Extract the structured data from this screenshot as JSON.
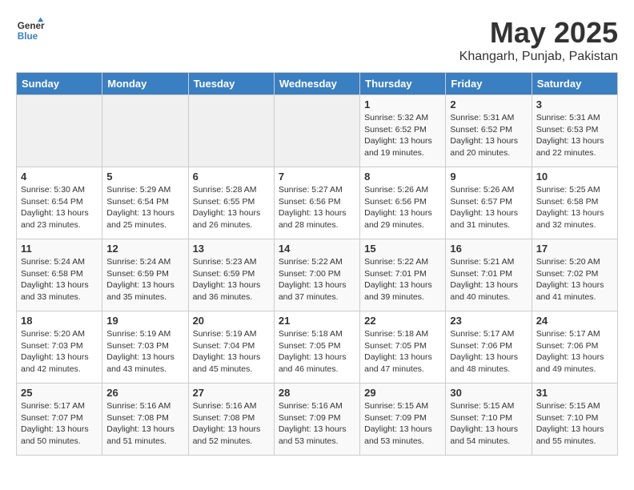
{
  "header": {
    "logo_line1": "General",
    "logo_line2": "Blue",
    "month_year": "May 2025",
    "location": "Khangarh, Punjab, Pakistan"
  },
  "days_of_week": [
    "Sunday",
    "Monday",
    "Tuesday",
    "Wednesday",
    "Thursday",
    "Friday",
    "Saturday"
  ],
  "weeks": [
    [
      {
        "num": "",
        "empty": true
      },
      {
        "num": "",
        "empty": true
      },
      {
        "num": "",
        "empty": true
      },
      {
        "num": "",
        "empty": true
      },
      {
        "num": "1",
        "info": "Sunrise: 5:32 AM\nSunset: 6:52 PM\nDaylight: 13 hours\nand 19 minutes."
      },
      {
        "num": "2",
        "info": "Sunrise: 5:31 AM\nSunset: 6:52 PM\nDaylight: 13 hours\nand 20 minutes."
      },
      {
        "num": "3",
        "info": "Sunrise: 5:31 AM\nSunset: 6:53 PM\nDaylight: 13 hours\nand 22 minutes."
      }
    ],
    [
      {
        "num": "4",
        "info": "Sunrise: 5:30 AM\nSunset: 6:54 PM\nDaylight: 13 hours\nand 23 minutes."
      },
      {
        "num": "5",
        "info": "Sunrise: 5:29 AM\nSunset: 6:54 PM\nDaylight: 13 hours\nand 25 minutes."
      },
      {
        "num": "6",
        "info": "Sunrise: 5:28 AM\nSunset: 6:55 PM\nDaylight: 13 hours\nand 26 minutes."
      },
      {
        "num": "7",
        "info": "Sunrise: 5:27 AM\nSunset: 6:56 PM\nDaylight: 13 hours\nand 28 minutes."
      },
      {
        "num": "8",
        "info": "Sunrise: 5:26 AM\nSunset: 6:56 PM\nDaylight: 13 hours\nand 29 minutes."
      },
      {
        "num": "9",
        "info": "Sunrise: 5:26 AM\nSunset: 6:57 PM\nDaylight: 13 hours\nand 31 minutes."
      },
      {
        "num": "10",
        "info": "Sunrise: 5:25 AM\nSunset: 6:58 PM\nDaylight: 13 hours\nand 32 minutes."
      }
    ],
    [
      {
        "num": "11",
        "info": "Sunrise: 5:24 AM\nSunset: 6:58 PM\nDaylight: 13 hours\nand 33 minutes."
      },
      {
        "num": "12",
        "info": "Sunrise: 5:24 AM\nSunset: 6:59 PM\nDaylight: 13 hours\nand 35 minutes."
      },
      {
        "num": "13",
        "info": "Sunrise: 5:23 AM\nSunset: 6:59 PM\nDaylight: 13 hours\nand 36 minutes."
      },
      {
        "num": "14",
        "info": "Sunrise: 5:22 AM\nSunset: 7:00 PM\nDaylight: 13 hours\nand 37 minutes."
      },
      {
        "num": "15",
        "info": "Sunrise: 5:22 AM\nSunset: 7:01 PM\nDaylight: 13 hours\nand 39 minutes."
      },
      {
        "num": "16",
        "info": "Sunrise: 5:21 AM\nSunset: 7:01 PM\nDaylight: 13 hours\nand 40 minutes."
      },
      {
        "num": "17",
        "info": "Sunrise: 5:20 AM\nSunset: 7:02 PM\nDaylight: 13 hours\nand 41 minutes."
      }
    ],
    [
      {
        "num": "18",
        "info": "Sunrise: 5:20 AM\nSunset: 7:03 PM\nDaylight: 13 hours\nand 42 minutes."
      },
      {
        "num": "19",
        "info": "Sunrise: 5:19 AM\nSunset: 7:03 PM\nDaylight: 13 hours\nand 43 minutes."
      },
      {
        "num": "20",
        "info": "Sunrise: 5:19 AM\nSunset: 7:04 PM\nDaylight: 13 hours\nand 45 minutes."
      },
      {
        "num": "21",
        "info": "Sunrise: 5:18 AM\nSunset: 7:05 PM\nDaylight: 13 hours\nand 46 minutes."
      },
      {
        "num": "22",
        "info": "Sunrise: 5:18 AM\nSunset: 7:05 PM\nDaylight: 13 hours\nand 47 minutes."
      },
      {
        "num": "23",
        "info": "Sunrise: 5:17 AM\nSunset: 7:06 PM\nDaylight: 13 hours\nand 48 minutes."
      },
      {
        "num": "24",
        "info": "Sunrise: 5:17 AM\nSunset: 7:06 PM\nDaylight: 13 hours\nand 49 minutes."
      }
    ],
    [
      {
        "num": "25",
        "info": "Sunrise: 5:17 AM\nSunset: 7:07 PM\nDaylight: 13 hours\nand 50 minutes."
      },
      {
        "num": "26",
        "info": "Sunrise: 5:16 AM\nSunset: 7:08 PM\nDaylight: 13 hours\nand 51 minutes."
      },
      {
        "num": "27",
        "info": "Sunrise: 5:16 AM\nSunset: 7:08 PM\nDaylight: 13 hours\nand 52 minutes."
      },
      {
        "num": "28",
        "info": "Sunrise: 5:16 AM\nSunset: 7:09 PM\nDaylight: 13 hours\nand 53 minutes."
      },
      {
        "num": "29",
        "info": "Sunrise: 5:15 AM\nSunset: 7:09 PM\nDaylight: 13 hours\nand 53 minutes."
      },
      {
        "num": "30",
        "info": "Sunrise: 5:15 AM\nSunset: 7:10 PM\nDaylight: 13 hours\nand 54 minutes."
      },
      {
        "num": "31",
        "info": "Sunrise: 5:15 AM\nSunset: 7:10 PM\nDaylight: 13 hours\nand 55 minutes."
      }
    ]
  ]
}
